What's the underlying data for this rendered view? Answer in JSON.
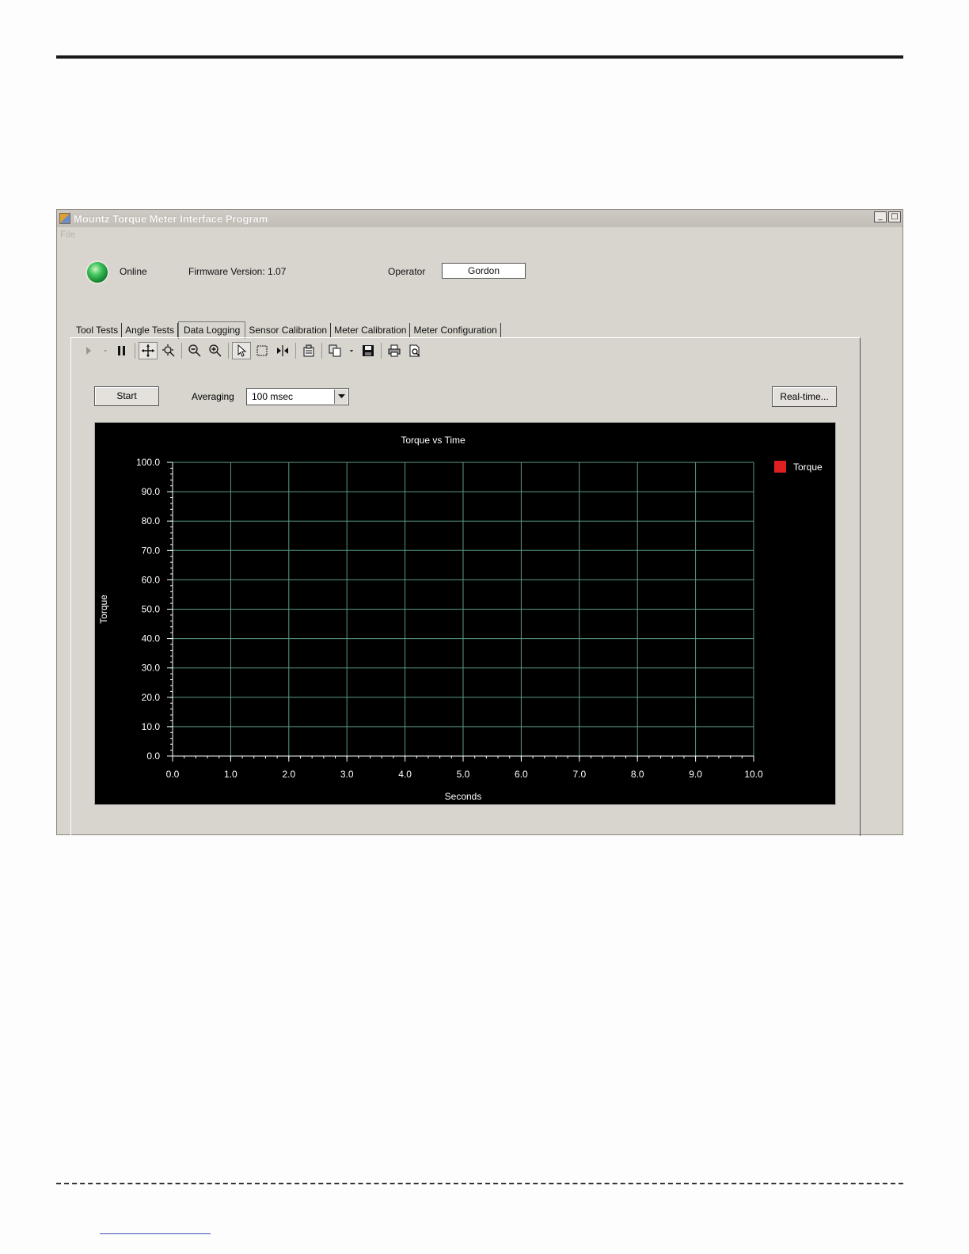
{
  "window": {
    "title": "Mountz Torque Meter Interface Program",
    "menu_file": "File",
    "btn_min": "_",
    "btn_max": "□"
  },
  "status": {
    "online_label": "Online",
    "firmware_label": "Firmware Version: 1.07",
    "operator_label": "Operator",
    "operator_value": "Gordon"
  },
  "tabs": [
    {
      "label": "Tool Tests"
    },
    {
      "label": "Angle Tests"
    },
    {
      "label": "Data Logging"
    },
    {
      "label": "Sensor Calibration"
    },
    {
      "label": "Meter Calibration"
    },
    {
      "label": "Meter Configuration"
    }
  ],
  "controls": {
    "start_label": "Start",
    "averaging_label": "Averaging",
    "averaging_value": "100 msec",
    "realtime_label": "Real-time..."
  },
  "toolbar_icons": [
    "play-icon",
    "dropdown-icon",
    "pause-icon",
    "pan-icon",
    "zoom-extent-icon",
    "zoom-out-icon",
    "zoom-in-icon",
    "select-cursor-icon",
    "zoom-box-icon",
    "cursor-measure-icon",
    "properties-icon",
    "copy-icon",
    "dropdown-icon",
    "save-icon",
    "print-icon",
    "print-preview-icon"
  ],
  "colors": {
    "chart_bg": "#000000",
    "grid": "#5a9a8a",
    "series": "#e02020",
    "led": "#2fb54a"
  },
  "chart_data": {
    "type": "line",
    "title": "Torque vs Time",
    "xlabel": "Seconds",
    "ylabel": "Torque",
    "xlim": [
      0,
      10
    ],
    "ylim": [
      0,
      100
    ],
    "xticks": [
      "0.0",
      "1.0",
      "2.0",
      "3.0",
      "4.0",
      "5.0",
      "6.0",
      "7.0",
      "8.0",
      "9.0",
      "10.0"
    ],
    "yticks": [
      "0.0",
      "10.0",
      "20.0",
      "30.0",
      "40.0",
      "50.0",
      "60.0",
      "70.0",
      "80.0",
      "90.0",
      "100.0"
    ],
    "grid": true,
    "legend_position": "top-right",
    "series": [
      {
        "name": "Torque",
        "color": "#e02020",
        "x": [],
        "y": []
      }
    ]
  }
}
